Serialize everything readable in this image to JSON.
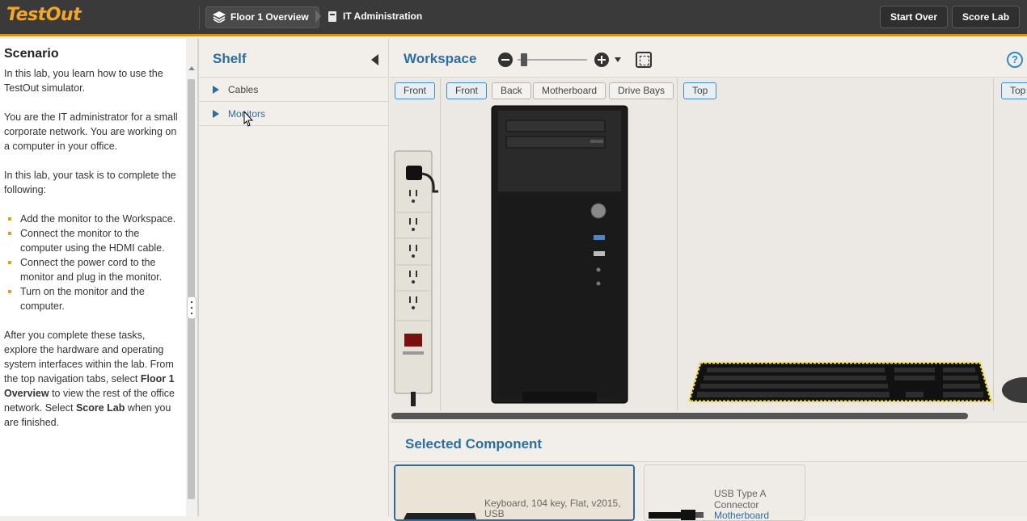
{
  "app": {
    "logo": "TestOut"
  },
  "header": {
    "crumb1": "Floor 1 Overview",
    "crumb2": "IT Administration",
    "start_over": "Start Over",
    "score_lab": "Score Lab"
  },
  "scenario": {
    "title": "Scenario",
    "p1": "In this lab, you learn how to use the TestOut simulator.",
    "p2": "You are the IT administrator for a small corporate network. You are working on a computer in your office.",
    "p3": "In this lab, your task is to complete the following:",
    "tasks": [
      "Add the monitor to the Workspace.",
      "Connect the monitor to the computer using the HDMI cable.",
      "Connect the power cord to the monitor and plug in the monitor.",
      "Turn on the monitor and the computer."
    ],
    "p4_a": "After you complete these tasks, explore the hardware and operating system interfaces within the lab. From the top navigation tabs, select ",
    "p4_b": "Floor 1 Overview",
    "p4_c": " to view the rest of the office network. Select ",
    "p4_d": "Score Lab",
    "p4_e": " when you are finished."
  },
  "shelf": {
    "title": "Shelf",
    "items": [
      "Cables",
      "Monitors"
    ]
  },
  "workspace": {
    "title": "Workspace",
    "help": "?",
    "views": [
      "Front",
      "Front",
      "Back",
      "Motherboard",
      "Drive Bays",
      "Top",
      "Top"
    ]
  },
  "selected": {
    "title": "Selected Component",
    "card1_text": "Keyboard, 104 key, Flat, v2015, USB",
    "card2_line1": "USB Type A",
    "card2_line2": "Connector",
    "card2_link": "Motherboard"
  }
}
